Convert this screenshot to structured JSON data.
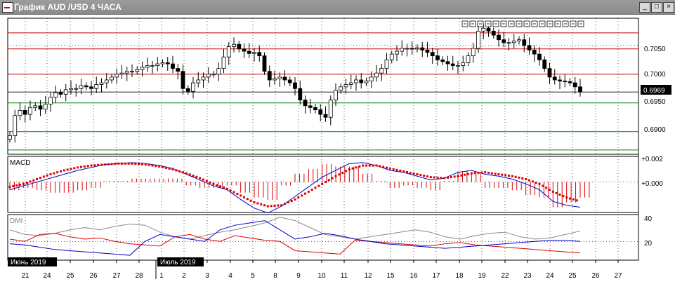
{
  "window": {
    "title": "График AUD /USD  4 ЧАСА",
    "buttons": {
      "minimize": "_",
      "maximize": "□",
      "close": "×"
    }
  },
  "price_panel": {
    "current_price": "0.6969",
    "y_ticks": [
      "0.7050",
      "0.7000",
      "0.6950",
      "0.6900"
    ]
  },
  "macd_panel": {
    "label": "MACD",
    "y_ticks": [
      "+0.002",
      "+0.000"
    ]
  },
  "dmi_panel": {
    "label": "DMI",
    "y_ticks": [
      "40",
      "20"
    ]
  },
  "time_axis": {
    "month_labels": [
      "Июнь 2019",
      "Июль 2019"
    ],
    "day_labels": [
      "21",
      "24",
      "25",
      "26",
      "27",
      "28",
      "1",
      "2",
      "3",
      "4",
      "5",
      "8",
      "9",
      "10",
      "11",
      "12",
      "15",
      "16",
      "17",
      "18",
      "19",
      "22",
      "23",
      "24",
      "25",
      "26",
      "27"
    ]
  },
  "colors": {
    "candle_up": "#ffffff",
    "candle_down": "#000000",
    "macd_line": "#0000cc",
    "macd_signal": "#dd0000",
    "dmi_plus": "#0000cc",
    "dmi_minus": "#dd0000",
    "adx": "#888888",
    "resistance": "#cc0000",
    "support": "#008800"
  },
  "chart_data": [
    {
      "type": "line",
      "title": "",
      "ylim": [
        0.6863,
        0.7095
      ],
      "horizontal_levels": {
        "resistance": [
          0.7072,
          0.7044,
          0.7
        ],
        "support": [
          0.695,
          0.69,
          0.6868
        ],
        "last_price": 0.6969
      },
      "series": [
        {
          "values": [
            0.6893,
            0.6928,
            0.6937,
            0.693,
            0.6942,
            0.6945,
            0.6939,
            0.6948,
            0.696,
            0.6968,
            0.6965,
            0.6973,
            0.6975,
            0.6975,
            0.698,
            0.6978,
            0.6975,
            0.6982,
            0.6985,
            0.699,
            0.6995,
            0.7,
            0.7002,
            0.7005,
            0.7005,
            0.7008,
            0.7012,
            0.7015,
            0.7015,
            0.7018,
            0.702,
            0.7018,
            0.701,
            0.7005,
            0.6975,
            0.697,
            0.6985,
            0.699,
            0.6995,
            0.7,
            0.7,
            0.701,
            0.703,
            0.7048,
            0.7052,
            0.7044,
            0.704,
            0.7036,
            0.7038,
            0.7032,
            0.7005,
            0.699,
            0.6992,
            0.6995,
            0.699,
            0.6985,
            0.6975,
            0.6955,
            0.6945,
            0.6942,
            0.6938,
            0.693,
            0.6925,
            0.6955,
            0.6972,
            0.6978,
            0.6982,
            0.6985,
            0.699,
            0.6985,
            0.6988,
            0.6995,
            0.7002,
            0.701,
            0.7025,
            0.7035,
            0.704,
            0.7045,
            0.7045,
            0.7044,
            0.7046,
            0.7042,
            0.7038,
            0.7032,
            0.7025,
            0.7022,
            0.7018,
            0.7015,
            0.7015,
            0.702,
            0.7032,
            0.7045,
            0.7075,
            0.708,
            0.7075,
            0.7068,
            0.706,
            0.7055,
            0.7055,
            0.7058,
            0.706,
            0.705,
            0.7042,
            0.7035,
            0.7025,
            0.701,
            0.6995,
            0.699,
            0.6988,
            0.6987,
            0.6985,
            0.6978,
            0.6969
          ]
        },
        {
          "name": "MACD",
          "values": [
            -0.0008,
            -0.0004,
            0.0,
            0.0004,
            0.0008,
            0.0012,
            0.0015,
            0.0018,
            0.0019,
            0.002,
            0.0019,
            0.0017,
            0.0014,
            0.0008,
            0.0002,
            -0.0004,
            -0.0008,
            -0.0018,
            -0.0027,
            -0.0032,
            -0.0025,
            -0.0015,
            -0.0005,
            0.0005,
            0.0012,
            0.0019,
            0.002,
            0.0017,
            0.0012,
            0.001,
            0.0006,
            0.0002,
            0.0004,
            0.001,
            0.0012,
            0.0008,
            0.0006,
            0.0003,
            -0.0002,
            -0.0008,
            -0.002,
            -0.0024,
            -0.0026
          ]
        },
        {
          "name": "Signal",
          "values": [
            -0.0005,
            -0.0002,
            0.0003,
            0.0008,
            0.0012,
            0.0015,
            0.0017,
            0.0018,
            0.0019,
            0.0019,
            0.0018,
            0.0016,
            0.0013,
            0.0009,
            0.0004,
            -0.0002,
            -0.0007,
            -0.0014,
            -0.0021,
            -0.0025,
            -0.0024,
            -0.0018,
            -0.001,
            -0.0002,
            0.0006,
            0.0013,
            0.0017,
            0.0017,
            0.0014,
            0.0011,
            0.0008,
            0.0005,
            0.0004,
            0.0006,
            0.0009,
            0.001,
            0.0008,
            0.0006,
            0.0003,
            -0.0002,
            -0.001,
            -0.0016,
            -0.002
          ]
        },
        {
          "name": "+DI",
          "values": [
            18,
            17,
            15,
            13,
            12,
            11,
            10,
            9,
            8,
            20,
            26,
            24,
            22,
            20,
            30,
            34,
            36,
            38,
            30,
            22,
            24,
            27,
            25,
            22,
            20,
            18,
            17,
            16,
            15,
            14,
            15,
            16,
            17,
            18,
            19,
            20,
            21,
            21,
            20
          ]
        },
        {
          "name": "-DI",
          "values": [
            22,
            20,
            26,
            27,
            24,
            22,
            23,
            20,
            18,
            17,
            16,
            24,
            26,
            22,
            20,
            25,
            23,
            21,
            20,
            12,
            11,
            10,
            9,
            21,
            20,
            19,
            18,
            17,
            16,
            18,
            19,
            17,
            16,
            15,
            14,
            13,
            12,
            11,
            10
          ]
        },
        {
          "name": "ADX",
          "values": [
            30,
            26,
            25,
            27,
            30,
            32,
            30,
            33,
            35,
            34,
            28,
            24,
            22,
            25,
            28,
            30,
            33,
            36,
            41,
            38,
            32,
            26,
            24,
            22,
            24,
            26,
            28,
            30,
            28,
            24,
            22,
            25,
            27,
            28,
            24,
            22,
            23,
            26,
            29
          ]
        }
      ]
    }
  ]
}
